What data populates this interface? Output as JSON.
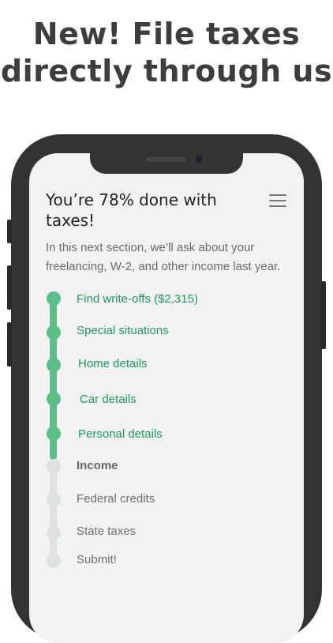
{
  "headline": {
    "line1": "New! File taxes",
    "line2": "directly through us"
  },
  "screen": {
    "title": "You’re 78% done with taxes!",
    "progress_percent": 78,
    "intro": "In this next section, we’ll ask about your freelancing, W-2, and other income last year.",
    "menu_icon": "hamburger-menu-icon"
  },
  "steps": [
    {
      "label": "Find write-offs ($2,315)",
      "status": "done"
    },
    {
      "label": "Special situations",
      "status": "done"
    },
    {
      "label": "Home details",
      "status": "done"
    },
    {
      "label": "Car details",
      "status": "done"
    },
    {
      "label": "Personal details",
      "status": "done"
    },
    {
      "label": "Income",
      "status": "current"
    },
    {
      "label": "Federal credits",
      "status": "todo"
    },
    {
      "label": "State taxes",
      "status": "todo"
    },
    {
      "label": "Submit!",
      "status": "todo"
    }
  ],
  "colors": {
    "done": "#5dbf88",
    "done_text": "#1f9a5b",
    "todo": "#dde2df",
    "frame": "#333333"
  }
}
